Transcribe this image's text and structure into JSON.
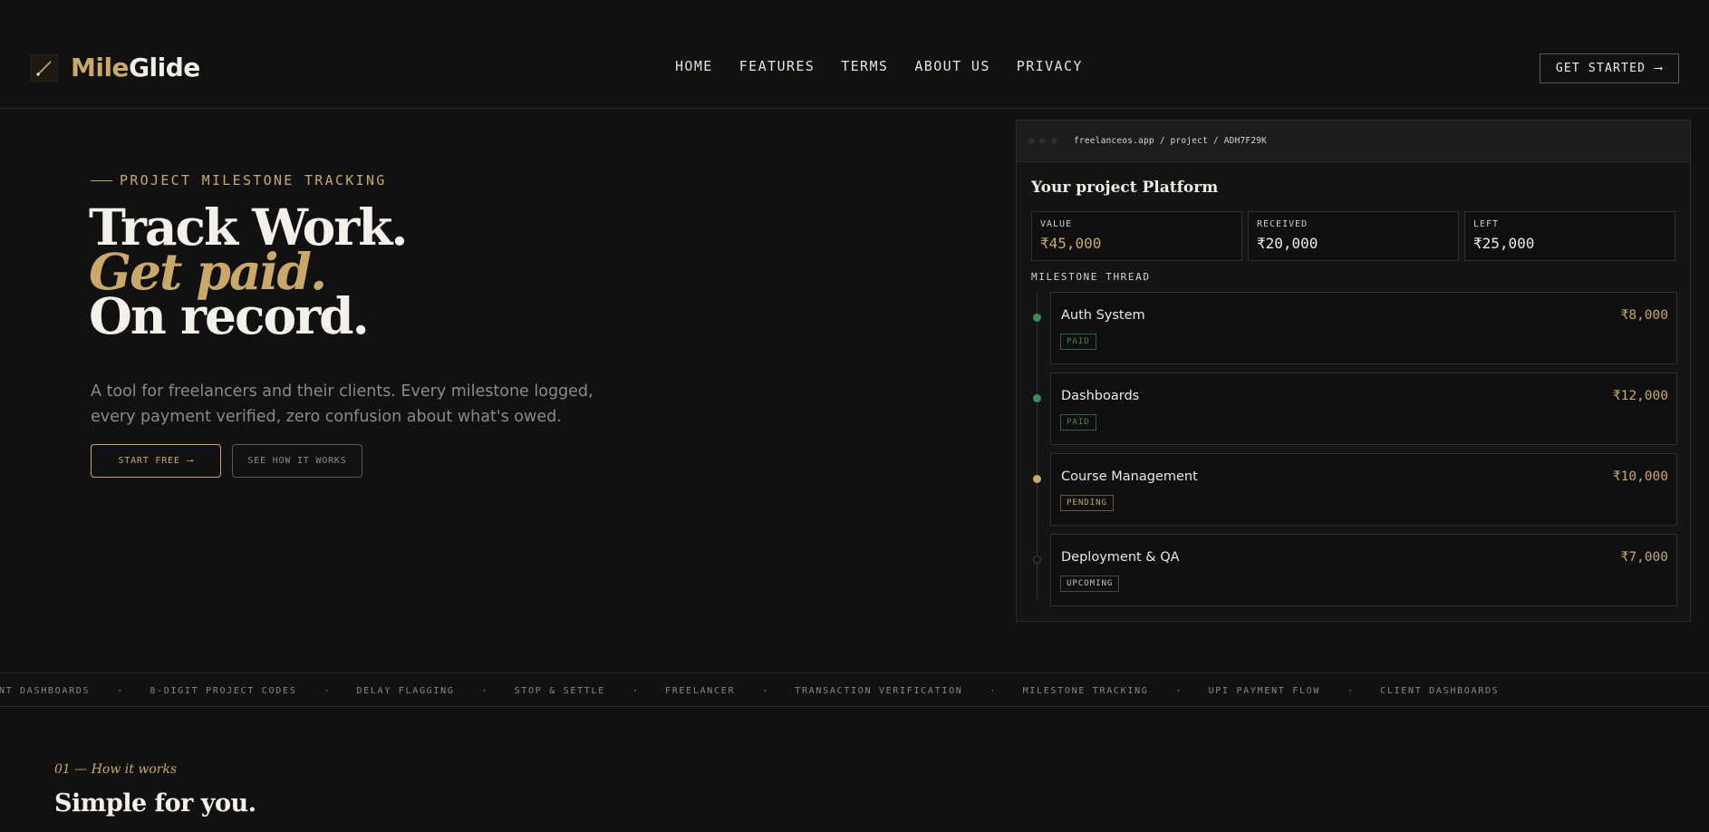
{
  "brand": {
    "mile": "Mile",
    "glide": "Glide"
  },
  "nav": [
    "HOME",
    "FEATURES",
    "TERMS",
    "ABOUT US",
    "PRIVACY"
  ],
  "cta_top": {
    "label": "GET STARTED",
    "arrow": "⟶"
  },
  "hero": {
    "eyebrow": "PROJECT MILESTONE TRACKING",
    "line1": "Track Work.",
    "line2": "Get paid.",
    "line3": "On record.",
    "subtext": "A tool for freelancers and their clients. Every milestone logged, every payment verified, zero confusion about what's owed.",
    "primary_btn": "START FREE",
    "primary_arrow": "⟶",
    "secondary_btn": "SEE HOW IT WORKS"
  },
  "preview": {
    "url": "freelanceos.app / project / ADH7F29K",
    "title": "Your project Platform",
    "stats": [
      {
        "label": "VALUE",
        "value": "₹45,000",
        "color": "#c9a86a"
      },
      {
        "label": "RECEIVED",
        "value": "₹20,000",
        "color": "#f0ece5"
      },
      {
        "label": "LEFT",
        "value": "₹25,000",
        "color": "#f0ece5"
      }
    ],
    "thread_label": "MILESTONE THREAD",
    "milestones": [
      {
        "title": "Auth System",
        "amount": "₹8,000",
        "status": "PAID",
        "status_color": "#3e8a5c",
        "dot": "#3e8a5c"
      },
      {
        "title": "Dashboards",
        "amount": "₹12,000",
        "status": "PAID",
        "status_color": "#3e8a5c",
        "dot": "#3e8a5c"
      },
      {
        "title": "Course Management",
        "amount": "₹10,000",
        "status": "PENDING",
        "status_color": "#c9a86a",
        "dot": "#c9a86a"
      },
      {
        "title": "Deployment & QA",
        "amount": "₹7,000",
        "status": "UPCOMING",
        "status_color": "#b8b4ad",
        "dot": "#3a3a3a"
      }
    ]
  },
  "ticker": [
    "CLIENT DASHBOARDS",
    "8-DIGIT PROJECT CODES",
    "DELAY FLAGGING",
    "STOP & SETTLE",
    "FREELANCER",
    "TRANSACTION VERIFICATION",
    "MILESTONE TRACKING",
    "UPI PAYMENT FLOW",
    "CLIENT DASHBOARDS"
  ],
  "ticker_sep": "·",
  "section": {
    "eyebrow": "01 — How it works",
    "title": "Simple for you."
  },
  "colors": {
    "accent": "#c9a86a",
    "background": "#111111",
    "paid": "#3e8a5c"
  }
}
